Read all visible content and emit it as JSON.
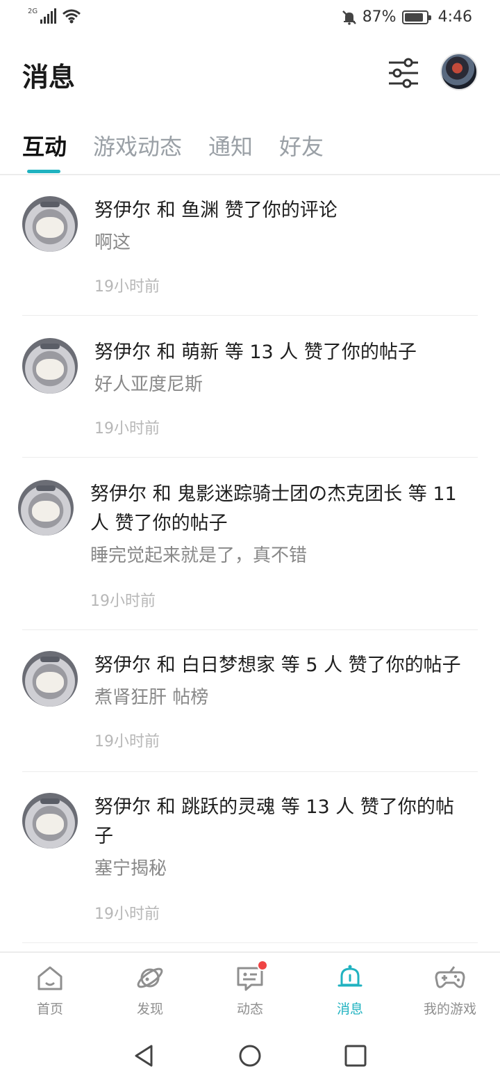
{
  "status_bar": {
    "network": "2G",
    "battery_percent": "87%",
    "battery_level": 0.87,
    "time": "4:46"
  },
  "header": {
    "title": "消息"
  },
  "tabs": [
    {
      "label": "互动",
      "active": true
    },
    {
      "label": "游戏动态",
      "active": false
    },
    {
      "label": "通知",
      "active": false
    },
    {
      "label": "好友",
      "active": false
    }
  ],
  "messages": [
    {
      "title_line1": "努伊尔 和 鱼渊 赞了你的评论",
      "title_line2": "",
      "subtitle": "啊这",
      "time": "19小时前"
    },
    {
      "title_line1": "努伊尔 和 萌新 等 13 人 赞了你的帖子",
      "title_line2": "",
      "subtitle": "好人亚度尼斯",
      "time": "19小时前"
    },
    {
      "title_line1": "努伊尔 和 鬼影迷踪骑士团の杰克团长 等 11",
      "title_line2": "人 赞了你的帖子",
      "subtitle": "睡完觉起来就是了，真不错",
      "time": "19小时前"
    },
    {
      "title_line1": "努伊尔 和 白日梦想家 等 5 人 赞了你的帖子",
      "title_line2": "",
      "subtitle": "煮肾狂肝 帖榜",
      "time": "19小时前"
    },
    {
      "title_line1": "努伊尔 和 跳跃的灵魂 等 13 人 赞了你的帖",
      "title_line2": "子",
      "subtitle": "塞宁揭秘",
      "time": "19小时前"
    }
  ],
  "bottom_nav": [
    {
      "label": "首页",
      "icon": "home-icon"
    },
    {
      "label": "发现",
      "icon": "planet-icon"
    },
    {
      "label": "动态",
      "icon": "chat-icon",
      "badge": true
    },
    {
      "label": "消息",
      "icon": "bell-icon",
      "active": true
    },
    {
      "label": "我的游戏",
      "icon": "gamepad-icon"
    }
  ],
  "colors": {
    "accent": "#20b2c0",
    "badge": "#ef4444"
  }
}
